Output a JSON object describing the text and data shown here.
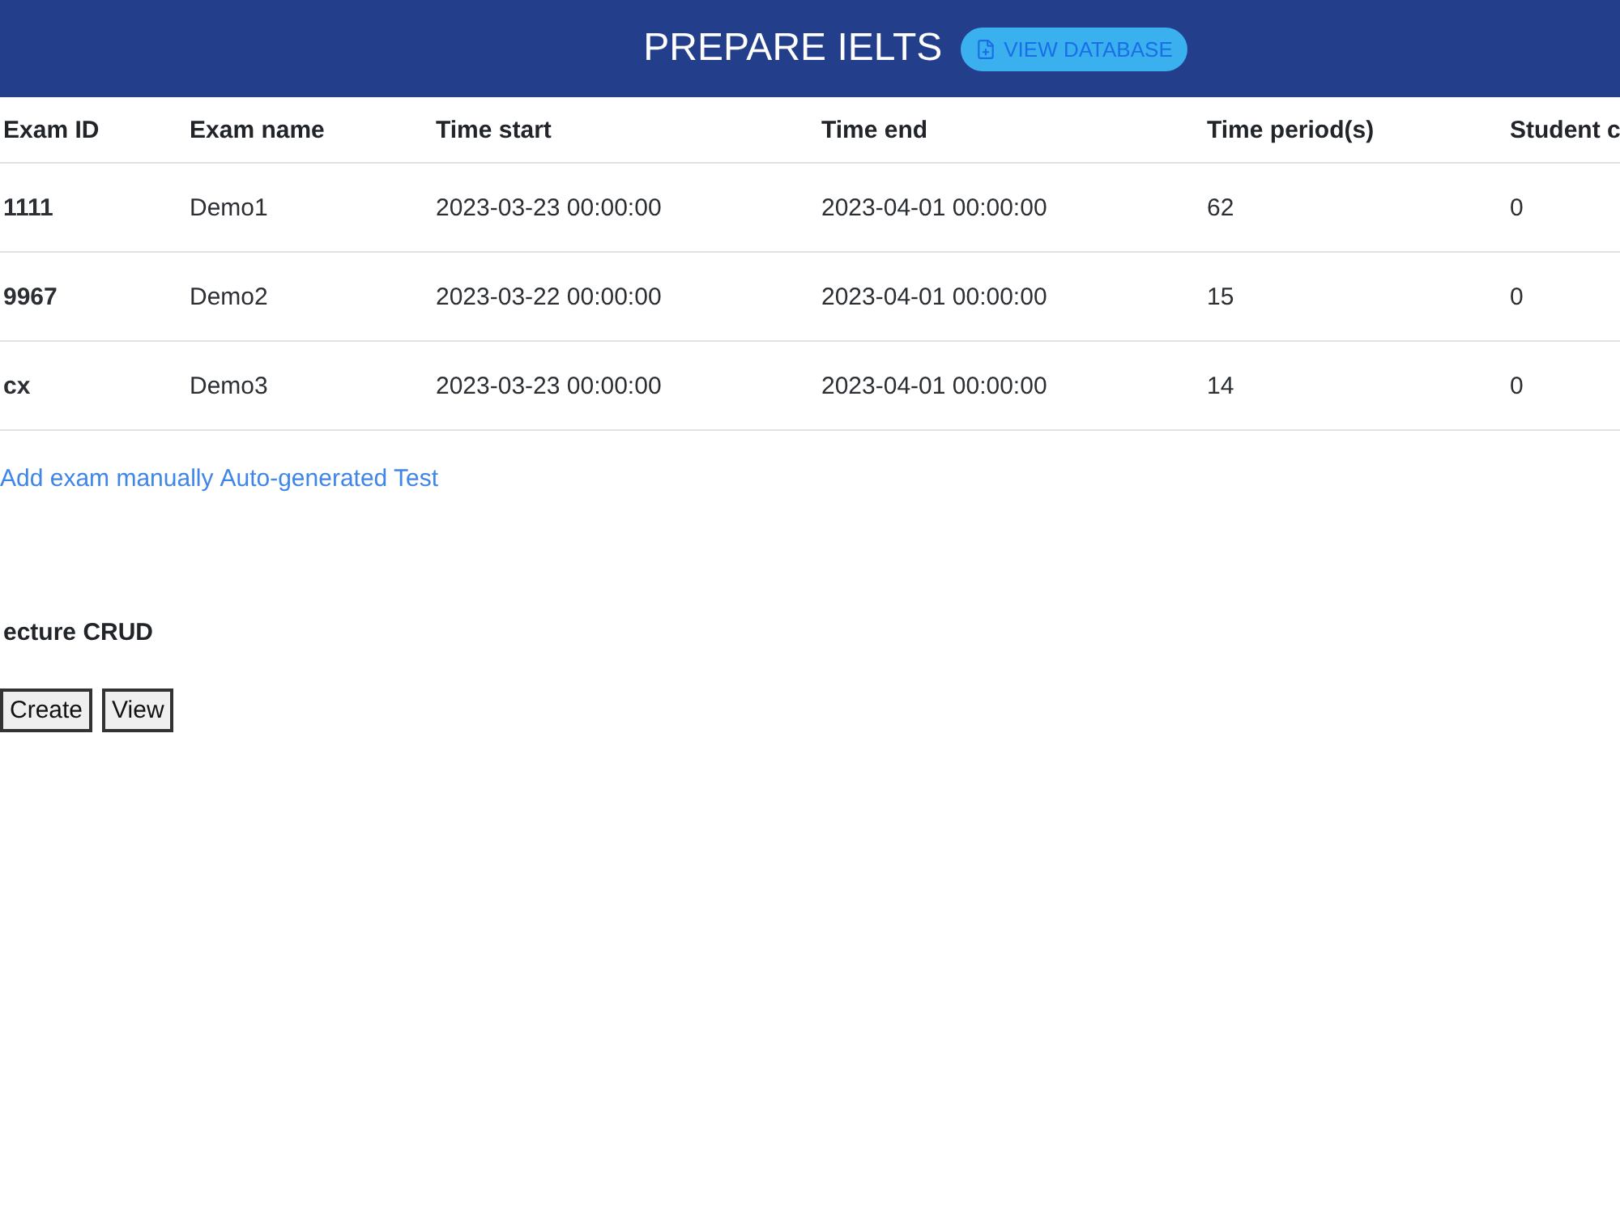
{
  "header": {
    "title": "PREPARE IELTS",
    "button": "VIEW DATABASE"
  },
  "table": {
    "columns": [
      "Exam ID",
      "Exam name",
      "Time start",
      "Time end",
      "Time period(s)",
      "Student c"
    ],
    "rows": [
      [
        "1111",
        "Demo1",
        "2023-03-23 00:00:00",
        "2023-04-01 00:00:00",
        "62",
        "0"
      ],
      [
        "9967",
        "Demo2",
        "2023-03-22 00:00:00",
        "2023-04-01 00:00:00",
        "15",
        "0"
      ],
      [
        "cx",
        "Demo3",
        "2023-03-23 00:00:00",
        "2023-04-01 00:00:00",
        "14",
        "0"
      ]
    ]
  },
  "links": [
    "Add exam manually",
    "Auto-generated Test"
  ],
  "lecture": {
    "title": "ecture CRUD",
    "buttons": [
      "Create",
      "View"
    ]
  }
}
